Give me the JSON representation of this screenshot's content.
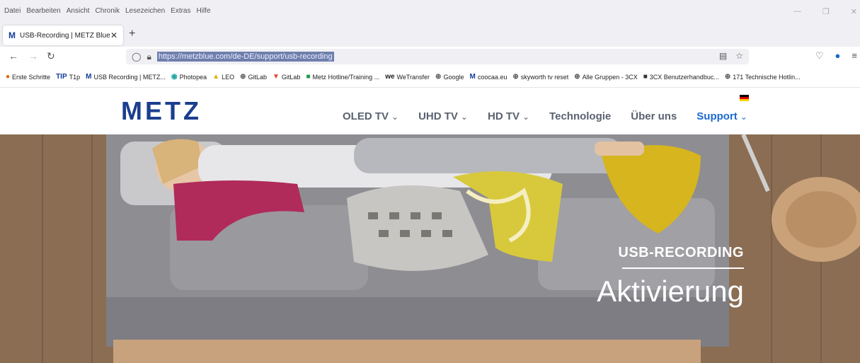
{
  "browser": {
    "menu": [
      "Datei",
      "Bearbeiten",
      "Ansicht",
      "Chronik",
      "Lesezeichen",
      "Extras",
      "Hilfe"
    ],
    "tab": {
      "favicon": "M",
      "title": "USB-Recording | METZ Blue"
    },
    "url": "https://metzblue.com/de-DE/support/usb-recording",
    "bookmarks": [
      {
        "icon": "firefox-icon",
        "label": "Erste Schritte"
      },
      {
        "icon": "tip-icon",
        "label": "T1p"
      },
      {
        "icon": "metz-icon",
        "label": "USB Recording | METZ..."
      },
      {
        "icon": "photopea-icon",
        "label": "Photopea"
      },
      {
        "icon": "leo-icon",
        "label": "LEO"
      },
      {
        "icon": "globe-icon",
        "label": "GitLab"
      },
      {
        "icon": "gitlab-icon",
        "label": "GitLab"
      },
      {
        "icon": "sheets-icon",
        "label": "Metz Hotline/Training ..."
      },
      {
        "icon": "wetransfer-icon",
        "label": "WeTransfer"
      },
      {
        "icon": "globe-icon",
        "label": "Google"
      },
      {
        "icon": "metz-icon",
        "label": "coocaa.eu"
      },
      {
        "icon": "globe-icon",
        "label": "skyworth tv reset"
      },
      {
        "icon": "globe-icon",
        "label": "Alle Gruppen - 3CX"
      },
      {
        "icon": "3cx-icon",
        "label": "3CX Benutzerhandbuc..."
      },
      {
        "icon": "globe-icon",
        "label": "171 Technische Hotlin..."
      }
    ]
  },
  "site": {
    "logo": "METZ",
    "nav": [
      {
        "label": "OLED TV",
        "dropdown": true
      },
      {
        "label": "UHD TV",
        "dropdown": true
      },
      {
        "label": "HD TV",
        "dropdown": true
      },
      {
        "label": "Technologie",
        "dropdown": false
      },
      {
        "label": "Über uns",
        "dropdown": false
      },
      {
        "label": "Support",
        "dropdown": true,
        "active": true
      }
    ],
    "language_flag": "de-flag-icon"
  },
  "hero": {
    "kicker": "USB-RECORDING",
    "title": "Aktivierung"
  },
  "colors": {
    "brand": "#1b3f8f",
    "accent": "#1b6ad1"
  }
}
